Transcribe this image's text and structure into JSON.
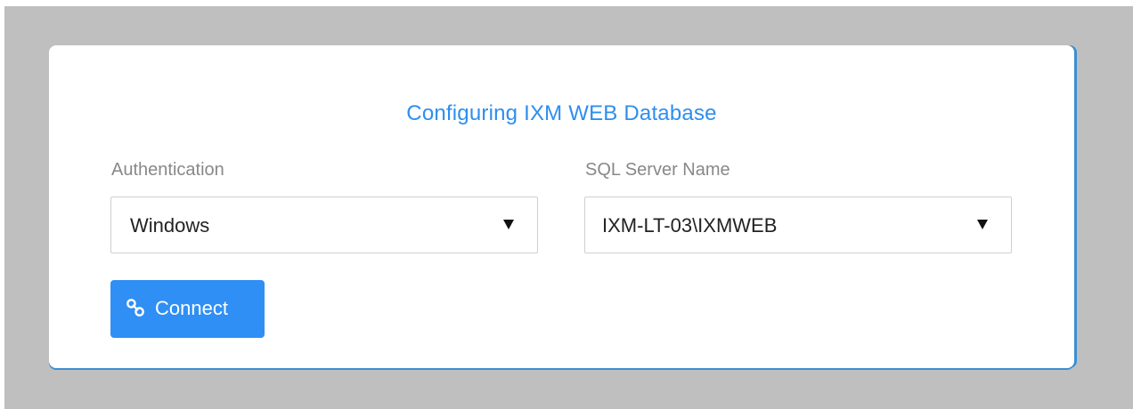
{
  "dialog": {
    "title": "Configuring IXM WEB Database",
    "authentication": {
      "label": "Authentication",
      "value": "Windows"
    },
    "sql_server": {
      "label": "SQL Server Name",
      "value": "IXM-LT-03\\IXMWEB"
    },
    "connect_button": {
      "label": "Connect",
      "icon": "link-icon"
    }
  },
  "colors": {
    "accent": "#2d8ef0",
    "button_bg": "#2f8ff4",
    "backdrop": "#bfbfbf"
  }
}
